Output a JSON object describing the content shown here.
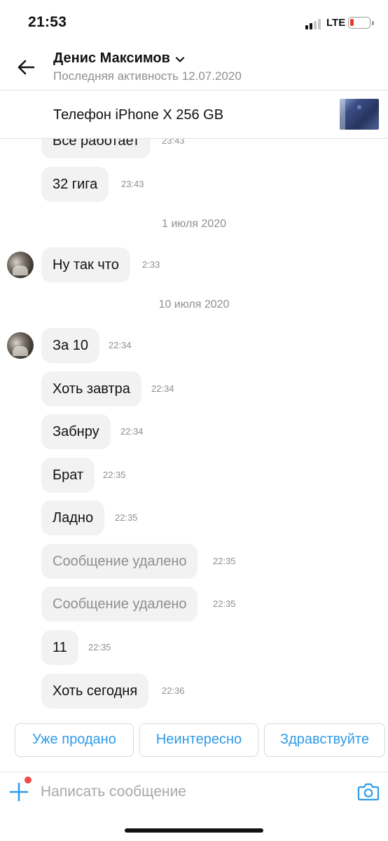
{
  "status_bar": {
    "time": "21:53",
    "network": "LTE",
    "signal_icon": "cellular-signal-icon",
    "battery_icon": "battery-low-icon",
    "battery_color": "#ef3a2a"
  },
  "header": {
    "contact_name": "Денис Максимов",
    "last_seen": "Последняя активность 12.07.2020",
    "back_icon": "arrow-left-icon",
    "chevron_icon": "chevron-down-icon"
  },
  "listing": {
    "title": "Телефон iPhone X 256 GB",
    "thumbnail": "phone-thumbnail"
  },
  "messages": [
    {
      "text": "Все работает",
      "time": "23:43"
    },
    {
      "text": "32 гига",
      "time": "23:43"
    },
    {
      "date": "1 июля 2020"
    },
    {
      "text": "Ну так что",
      "time": "2:33",
      "avatar": true
    },
    {
      "date": "10 июля 2020"
    },
    {
      "text": "За 10",
      "time": "22:34",
      "avatar": true
    },
    {
      "text": "Хоть завтра",
      "time": "22:34"
    },
    {
      "text": "Забнру",
      "time": "22:34"
    },
    {
      "text": "Брат",
      "time": "22:35"
    },
    {
      "text": "Ладно",
      "time": "22:35"
    },
    {
      "text": "Сообщение удалено",
      "time": "22:35",
      "deleted": true
    },
    {
      "text": "Сообщение удалено",
      "time": "22:35",
      "deleted": true
    },
    {
      "text": "11",
      "time": "22:35"
    },
    {
      "text": "Хоть сегодня",
      "time": "22:36"
    }
  ],
  "quick_replies": [
    "Уже продано",
    "Неинтересно",
    "Здравствуйте"
  ],
  "composer": {
    "placeholder": "Написать сообщение",
    "add_icon": "plus-icon",
    "camera_icon": "camera-icon"
  },
  "colors": {
    "accent": "#2f9be8",
    "bubble": "#f2f2f2",
    "muted_text": "#8f8f8f",
    "notification_dot": "#f24b4b"
  }
}
